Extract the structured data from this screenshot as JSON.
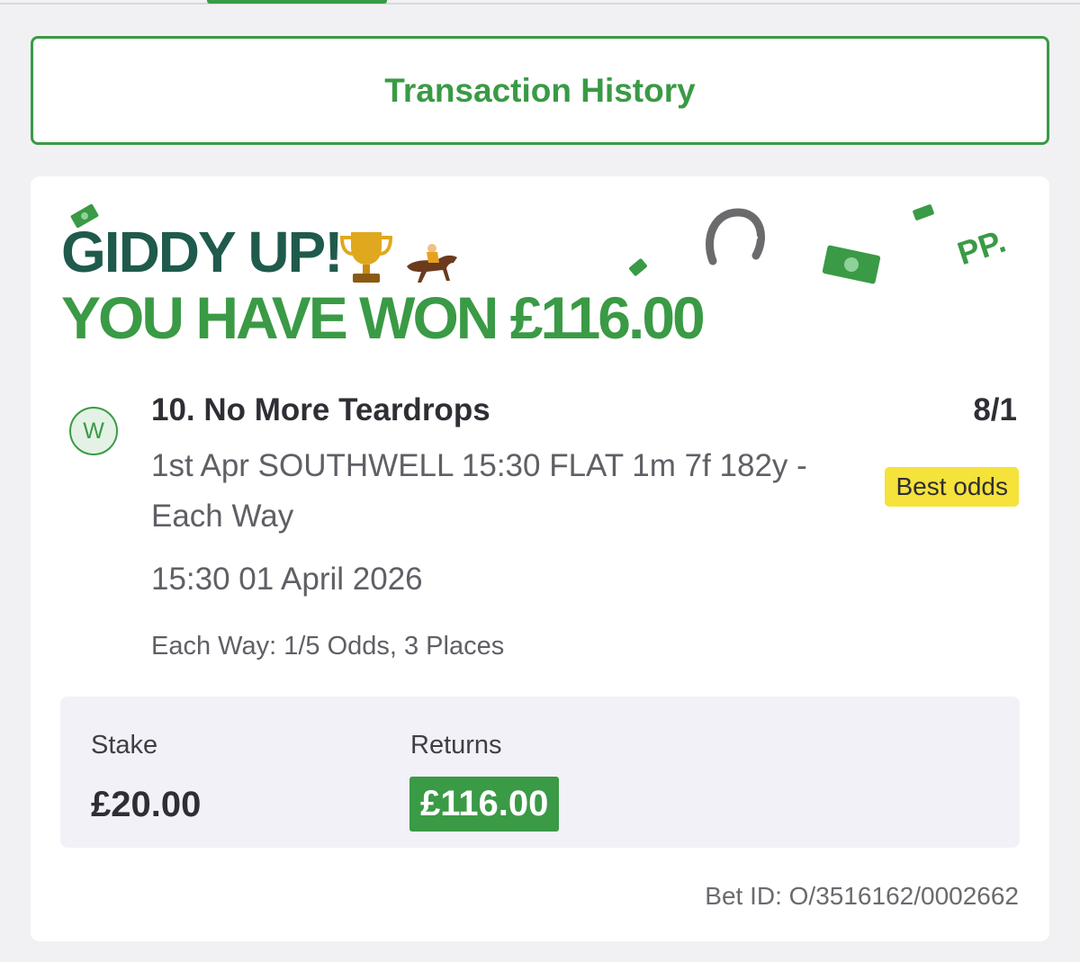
{
  "header": {
    "transaction_history_label": "Transaction History"
  },
  "win_banner": {
    "line1": "GIDDY UP!",
    "line2": "YOU HAVE WON £116.00",
    "brand_mark": "PP."
  },
  "selection": {
    "result_badge": "W",
    "name": "10. No More Teardrops",
    "odds": "8/1",
    "best_odds_label": "Best odds",
    "event": "1st Apr SOUTHWELL 15:30 FLAT 1m 7f 182y - Each Way",
    "datetime": "15:30 01 April 2026",
    "each_way_terms": "Each Way: 1/5 Odds, 3 Places"
  },
  "summary": {
    "stake_label": "Stake",
    "stake_value": "£20.00",
    "returns_label": "Returns",
    "returns_value": "£116.00"
  },
  "bet_id": "Bet ID: O/3516162/0002662",
  "colors": {
    "brand_green": "#3a9a45",
    "dark_green": "#1f5a4c",
    "best_odds_yellow": "#f5e23a"
  },
  "icons": [
    "money-note-icon",
    "trophy-icon",
    "horse-racing-icon",
    "horseshoe-icon"
  ]
}
